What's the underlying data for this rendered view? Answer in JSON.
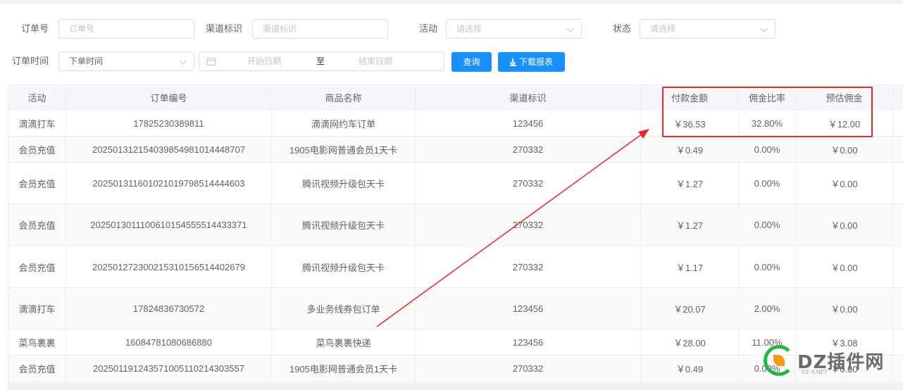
{
  "filters": {
    "order_no_label": "订单号",
    "order_no_placeholder": "订单号",
    "channel_label": "渠道标识",
    "channel_placeholder": "渠道标识",
    "activity_label": "活动",
    "activity_placeholder": "请选择",
    "status_label": "状态",
    "status_placeholder": "请选择",
    "order_time_label": "订单时间",
    "order_time_type": "下单时间",
    "date_start_placeholder": "开始日期",
    "date_separator": "至",
    "date_end_placeholder": "结束日期",
    "query_button": "查询",
    "download_button": "下载报表"
  },
  "table": {
    "headers": [
      "活动",
      "订单编号",
      "商品名称",
      "渠道标识",
      "付款金额",
      "佣金比率",
      "预估佣金"
    ],
    "rows": [
      {
        "activity": "滴滴打车",
        "order_no": "17825230389811",
        "product": "滴滴网约车订单",
        "channel": "123456",
        "amount": "￥36.53",
        "rate": "32.80%",
        "commission": "￥12.00"
      },
      {
        "activity": "会员充值",
        "order_no": "2025013121540398549810144 48707",
        "product": "1905电影网普通会员1天卡",
        "channel": "270332",
        "amount": "￥0.49",
        "rate": "0.00%",
        "commission": "￥0.00"
      },
      {
        "activity": "会员充值",
        "order_no": "20250131160102101979851444 4603",
        "product": "腾讯视频升级包天卡",
        "channel": "270332",
        "amount": "￥1.27",
        "rate": "0.00%",
        "commission": "￥0.00"
      },
      {
        "activity": "会员充值",
        "order_no": "20250130111006101545555144 33371",
        "product": "腾讯视频升级包天卡",
        "channel": "270332",
        "amount": "￥1.27",
        "rate": "0.00%",
        "commission": "￥0.00"
      },
      {
        "activity": "会员充值",
        "order_no": "2025012723002153101565144 02679",
        "product": "腾讯视频升级包天卡",
        "channel": "270332",
        "amount": "￥1.17",
        "rate": "0.00%",
        "commission": "￥0.00"
      },
      {
        "activity": "滴滴打车",
        "order_no": "17824836730572",
        "product": "多业务线券包订单",
        "channel": "123456",
        "amount": "￥20.07",
        "rate": "2.00%",
        "commission": "￥0.00"
      },
      {
        "activity": "菜鸟裹裹",
        "order_no": "16084781080686880",
        "product": "菜鸟裹裹快递",
        "channel": "123456",
        "amount": "￥28.00",
        "rate": "11.00%",
        "commission": "￥3.08"
      },
      {
        "activity": "会员充值",
        "order_no": "2025011912435710051102143 03557",
        "product": "1905电影网普通会员1天卡",
        "channel": "270332",
        "amount": "￥0.49",
        "rate": "0.00%",
        "commission": "￥0.00"
      }
    ]
  },
  "watermark": {
    "text": "DZ插件网",
    "sub": "DZ-X.NET"
  },
  "colors": {
    "primary": "#1890ff",
    "highlight": "#e8292a",
    "watermark_green": "#27b34a"
  }
}
